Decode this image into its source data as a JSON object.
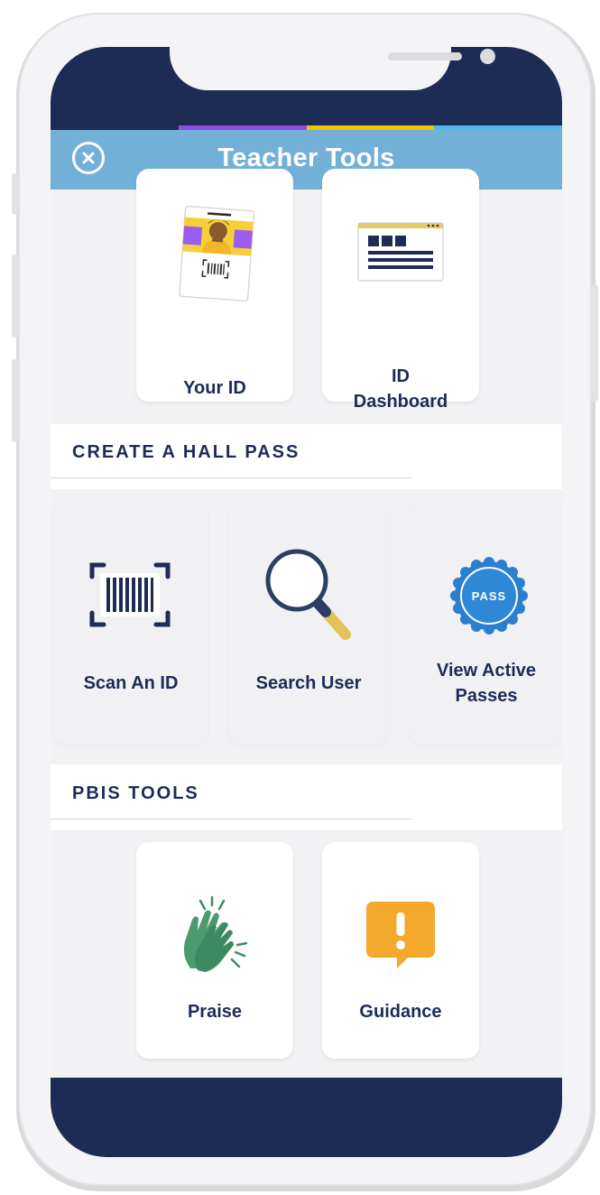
{
  "header": {
    "title": "Teacher Tools",
    "close_icon": "close-circle-icon"
  },
  "colors": {
    "navy": "#1c2c55",
    "header_blue": "#73b0d8",
    "stripes": [
      "#1c2c55",
      "#8b4fe0",
      "#f2c200",
      "#55b6e8"
    ]
  },
  "id_tools": {
    "your_id": {
      "label": "Your ID",
      "icon": "id-card-icon"
    },
    "id_dashboard": {
      "label": "ID\nDashboard",
      "icon": "dashboard-icon"
    }
  },
  "hall_pass": {
    "title": "CREATE A HALL PASS",
    "scan_id": {
      "label": "Scan An ID",
      "icon": "barcode-scan-icon"
    },
    "search_user": {
      "label": "Search User",
      "icon": "magnifier-icon"
    },
    "view_active": {
      "label": "View Active\nPasses",
      "icon": "pass-badge-icon",
      "badge_text": "PASS"
    }
  },
  "pbis": {
    "title": "PBIS TOOLS",
    "praise": {
      "label": "Praise",
      "icon": "clapping-hands-icon"
    },
    "guidance": {
      "label": "Guidance",
      "icon": "exclamation-bubble-icon"
    }
  }
}
